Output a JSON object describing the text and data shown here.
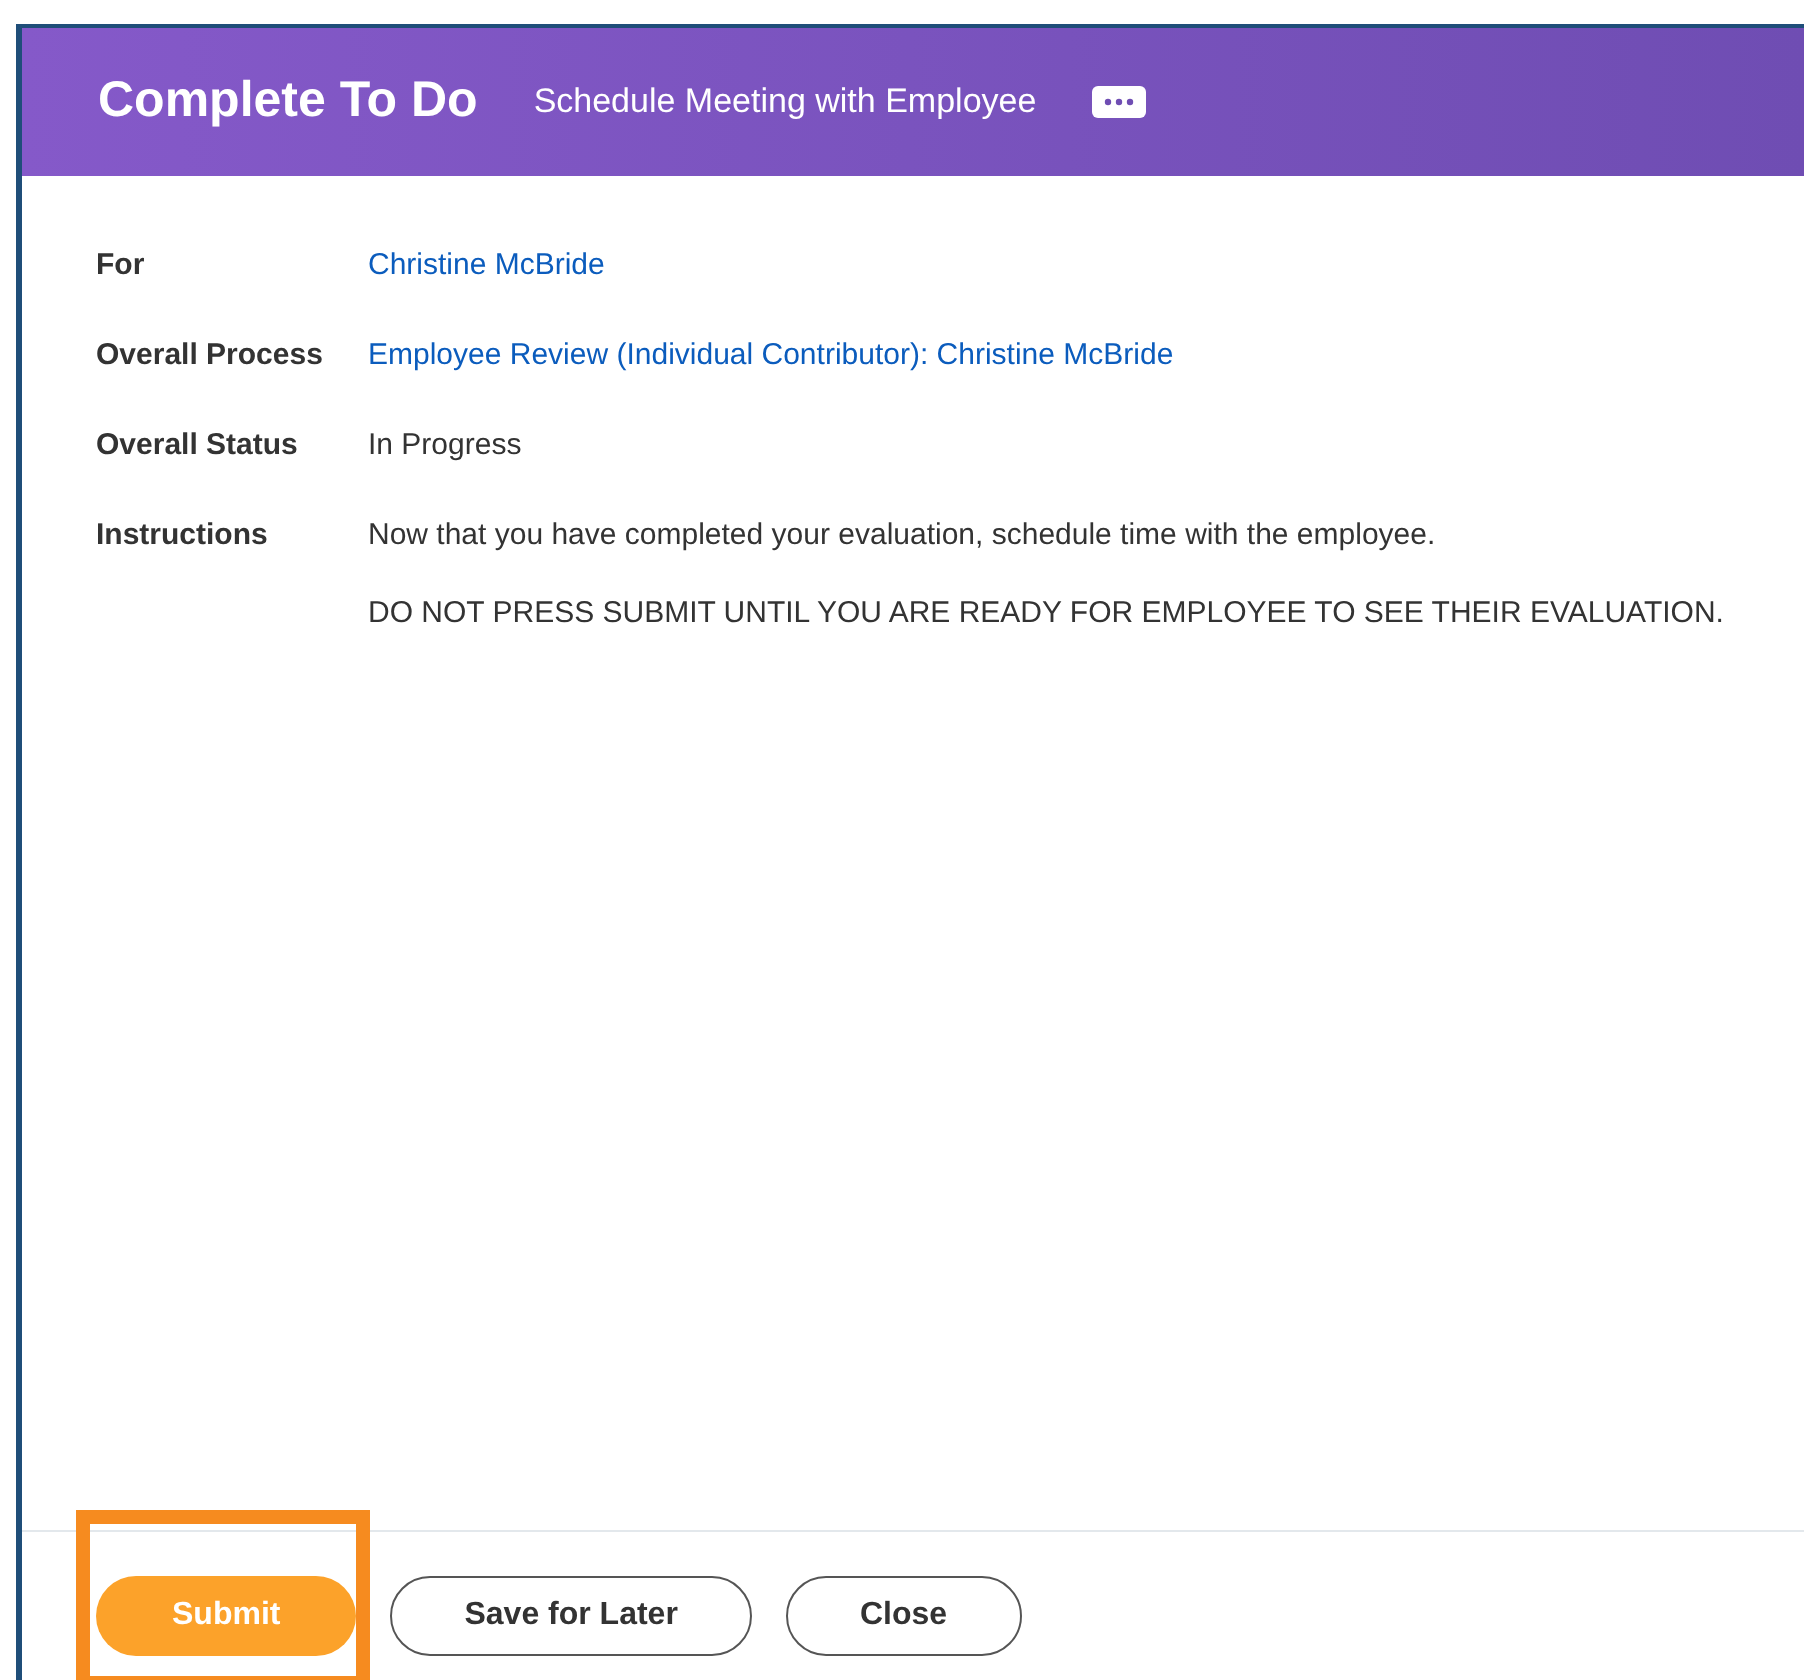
{
  "header": {
    "title": "Complete To Do",
    "subtitle": "Schedule Meeting with Employee"
  },
  "fields": [
    {
      "label": "For",
      "values": [
        {
          "kind": "link",
          "text": "Christine McBride"
        }
      ]
    },
    {
      "label": "Overall Process",
      "values": [
        {
          "kind": "link",
          "text": "Employee Review (Individual Contributor): Christine McBride"
        }
      ]
    },
    {
      "label": "Overall Status",
      "values": [
        {
          "kind": "text",
          "text": "In Progress"
        }
      ]
    },
    {
      "label": "Instructions",
      "values": [
        {
          "kind": "text",
          "text": "Now that you have completed your evaluation, schedule time with the employee."
        },
        {
          "kind": "text",
          "text": "DO NOT PRESS SUBMIT UNTIL YOU ARE READY FOR EMPLOYEE TO SEE THEIR EVALUATION."
        }
      ]
    }
  ],
  "buttons": [
    {
      "label": "Submit",
      "kind": "primary",
      "highlighted": true
    },
    {
      "label": "Save for Later",
      "kind": "secondary",
      "highlighted": false
    },
    {
      "label": "Close",
      "kind": "secondary",
      "highlighted": false
    }
  ]
}
